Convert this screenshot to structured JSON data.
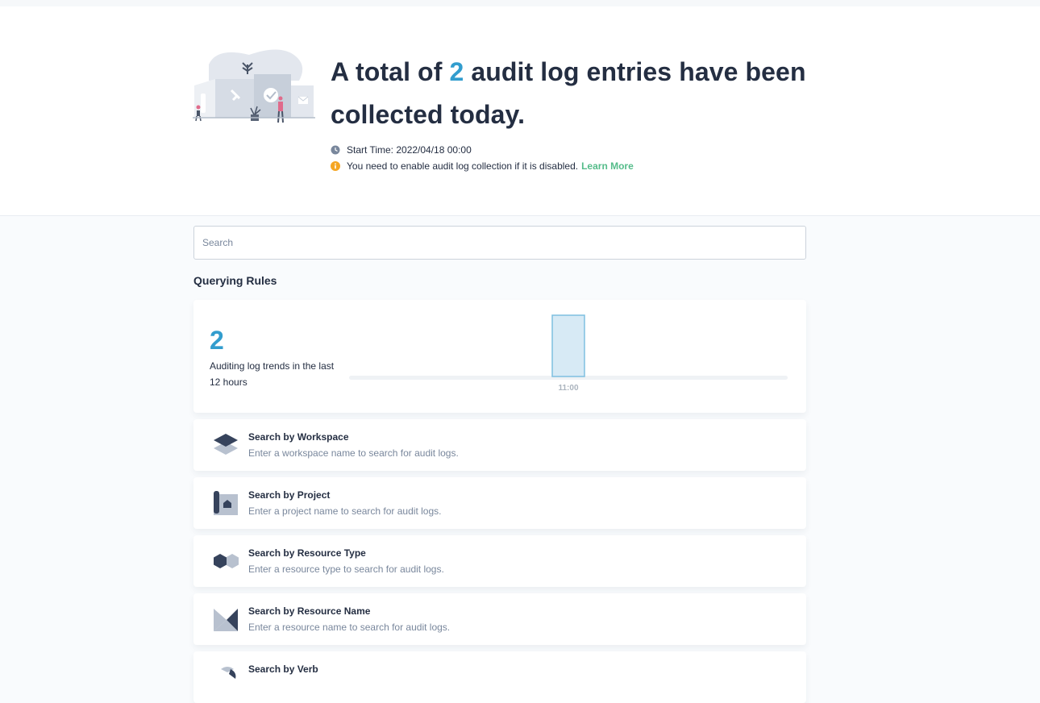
{
  "hero": {
    "title_prefix": "A total of",
    "count": "2",
    "title_suffix": "audit log entries have been collected today.",
    "start_time": "Start Time: 2022/04/18 00:00",
    "warning": "You need to enable audit log collection if it is disabled.",
    "learn_more": "Learn More"
  },
  "search": {
    "placeholder": "Search"
  },
  "querying_rules": {
    "title": "Querying Rules",
    "trend": {
      "count": "2",
      "description": "Auditing log trends in the last 12 hours"
    },
    "rules": [
      {
        "title": "Search by Workspace",
        "description": "Enter a workspace name to search for audit logs.",
        "icon": "workspace-icon"
      },
      {
        "title": "Search by Project",
        "description": "Enter a project name to search for audit logs.",
        "icon": "project-icon"
      },
      {
        "title": "Search by Resource Type",
        "description": "Enter a resource type to search for audit logs.",
        "icon": "resource-type-icon"
      },
      {
        "title": "Search by Resource Name",
        "description": "Enter a resource name to search for audit logs.",
        "icon": "resource-name-icon"
      },
      {
        "title": "Search by Verb",
        "description": "",
        "icon": "verb-icon"
      }
    ]
  },
  "chart_data": {
    "type": "bar",
    "categories": [
      "11:00"
    ],
    "values": [
      2
    ]
  },
  "colors": {
    "accent": "#329dce",
    "link": "#55bc8a",
    "warning": "#f5a623",
    "text": "#242e42",
    "muted": "#79879c"
  }
}
